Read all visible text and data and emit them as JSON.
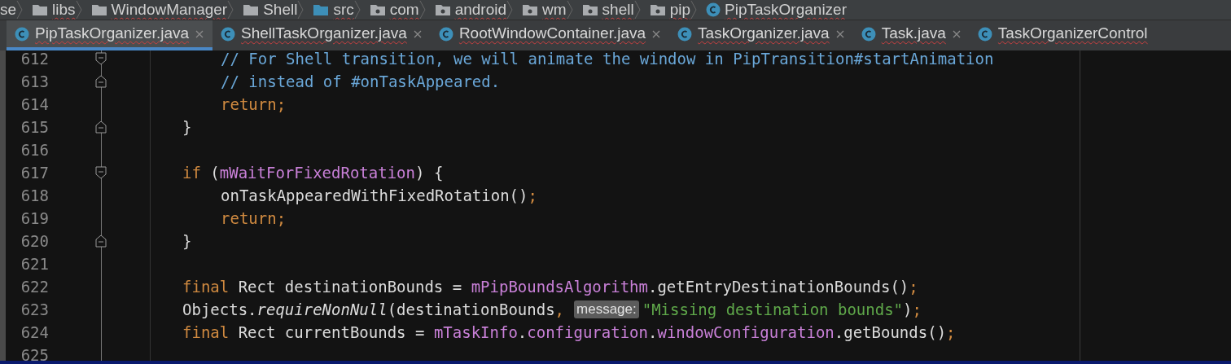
{
  "breadcrumbs": [
    {
      "label": "se",
      "kind": "text",
      "spell_warning": false
    },
    {
      "label": "libs",
      "kind": "folder",
      "spell_warning": true
    },
    {
      "label": "WindowManager",
      "kind": "folder",
      "spell_warning": true
    },
    {
      "label": "Shell",
      "kind": "folder",
      "spell_warning": false
    },
    {
      "label": "src",
      "kind": "source",
      "spell_warning": true
    },
    {
      "label": "com",
      "kind": "package",
      "spell_warning": true
    },
    {
      "label": "android",
      "kind": "package",
      "spell_warning": true
    },
    {
      "label": "wm",
      "kind": "package",
      "spell_warning": true
    },
    {
      "label": "shell",
      "kind": "package",
      "spell_warning": true
    },
    {
      "label": "pip",
      "kind": "package",
      "spell_warning": true
    },
    {
      "label": "PipTaskOrganizer",
      "kind": "class",
      "spell_warning": true
    }
  ],
  "tabs": [
    {
      "label": "PipTaskOrganizer.java",
      "selected": true,
      "closable": true
    },
    {
      "label": "ShellTaskOrganizer.java",
      "selected": false,
      "closable": true
    },
    {
      "label": "RootWindowContainer.java",
      "selected": false,
      "closable": true
    },
    {
      "label": "TaskOrganizer.java",
      "selected": false,
      "closable": true
    },
    {
      "label": "Task.java",
      "selected": false,
      "closable": true
    },
    {
      "label": "TaskOrganizerControl",
      "selected": false,
      "closable": false
    }
  ],
  "lines": [
    {
      "number": "612",
      "kind": "inner",
      "fold_start": true,
      "fold_end": false,
      "tokens": [
        {
          "kind": "comment",
          "text": "// For Shell transition, we will animate the window in PipTransition#startAnimation"
        }
      ]
    },
    {
      "number": "613",
      "kind": "inner",
      "fold_start": false,
      "fold_end": true,
      "tokens": [
        {
          "kind": "comment",
          "text": "// instead of #onTaskAppeared."
        }
      ]
    },
    {
      "number": "614",
      "kind": "inner",
      "fold_start": false,
      "fold_end": false,
      "tokens": [
        {
          "kind": "keyword",
          "text": "return;"
        }
      ]
    },
    {
      "number": "615",
      "kind": "outer",
      "fold_start": false,
      "fold_end": true,
      "tokens": [
        {
          "kind": "plain",
          "text": "}"
        }
      ]
    },
    {
      "number": "616",
      "kind": "outer",
      "fold_start": false,
      "fold_end": false
    },
    {
      "number": "617",
      "kind": "outer",
      "fold_start": true,
      "fold_end": false,
      "tokens": [
        {
          "kind": "keyword",
          "text": "if"
        },
        {
          "kind": "plain",
          "text": " ("
        },
        {
          "kind": "field",
          "text": "mWaitForFixedRotation"
        },
        {
          "kind": "plain",
          "text": ") {"
        }
      ]
    },
    {
      "number": "618",
      "kind": "inner",
      "fold_start": false,
      "fold_end": false,
      "tokens": [
        {
          "kind": "plain",
          "text": "onTaskAppearedWithFixedRotation()"
        },
        {
          "kind": "keyword",
          "text": ";"
        }
      ]
    },
    {
      "number": "619",
      "kind": "inner",
      "fold_start": false,
      "fold_end": false,
      "tokens": [
        {
          "kind": "keyword",
          "text": "return;"
        }
      ]
    },
    {
      "number": "620",
      "kind": "outer",
      "fold_start": false,
      "fold_end": true,
      "tokens": [
        {
          "kind": "plain",
          "text": "}"
        }
      ]
    },
    {
      "number": "621",
      "kind": "outer",
      "fold_start": false,
      "fold_end": false
    },
    {
      "number": "622",
      "kind": "outer",
      "fold_start": false,
      "fold_end": false,
      "tokens": [
        {
          "kind": "keyword",
          "text": "final"
        },
        {
          "kind": "plain",
          "text": " Rect destinationBounds = "
        },
        {
          "kind": "field",
          "text": "mPipBoundsAlgorithm"
        },
        {
          "kind": "plain",
          "text": ".getEntryDestinationBounds()"
        },
        {
          "kind": "keyword",
          "text": ";"
        }
      ]
    },
    {
      "number": "623",
      "kind": "outer",
      "fold_start": false,
      "fold_end": false,
      "tokens": [
        {
          "kind": "plain",
          "text": "Objects."
        },
        {
          "kind": "method_static",
          "text": "requireNonNull"
        },
        {
          "kind": "plain",
          "text": "(destinationBounds"
        },
        {
          "kind": "keyword",
          "text": ","
        },
        {
          "kind": "hint",
          "text": "message:"
        },
        {
          "kind": "string",
          "text": "\"Missing destination bounds\""
        },
        {
          "kind": "plain",
          "text": ")"
        },
        {
          "kind": "keyword",
          "text": ";"
        }
      ]
    },
    {
      "number": "624",
      "kind": "outer",
      "fold_start": false,
      "fold_end": false,
      "tokens": [
        {
          "kind": "keyword",
          "text": "final"
        },
        {
          "kind": "plain",
          "text": " Rect currentBounds = "
        },
        {
          "kind": "field",
          "text": "mTaskInfo"
        },
        {
          "kind": "plain",
          "text": "."
        },
        {
          "kind": "field",
          "text": "configuration"
        },
        {
          "kind": "plain",
          "text": "."
        },
        {
          "kind": "field",
          "text": "windowConfiguration"
        },
        {
          "kind": "plain",
          "text": ".getBounds()"
        },
        {
          "kind": "keyword",
          "text": ";"
        }
      ]
    },
    {
      "number": "625",
      "kind": "outer",
      "fold_start": false,
      "fold_end": false
    }
  ]
}
